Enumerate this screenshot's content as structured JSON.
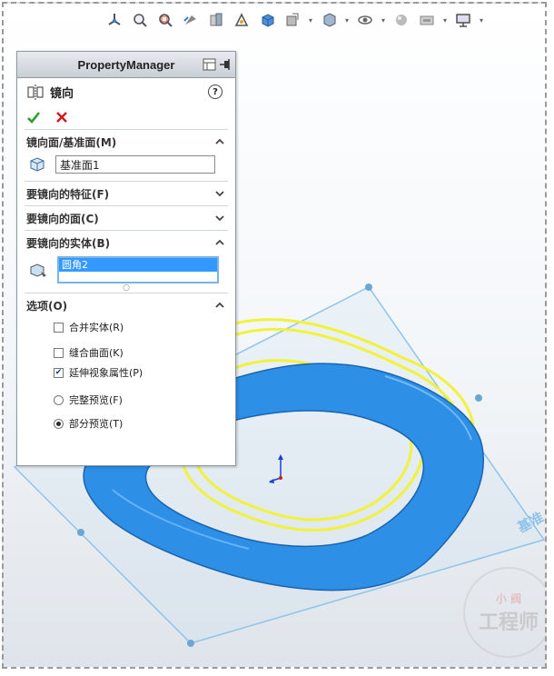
{
  "property_manager": {
    "title": "PropertyManager",
    "feature_name": "镜向",
    "help_glyph": "?",
    "sections": {
      "mirror_plane": {
        "label": "镜向面/基准面(M)",
        "value": "基准面1"
      },
      "features": {
        "label": "要镜向的特征(F)"
      },
      "faces": {
        "label": "要镜向的面(C)"
      },
      "bodies": {
        "label": "要镜向的实体(B)",
        "selected": "圆角2"
      },
      "options": {
        "label": "选项(O)",
        "merge_solids": {
          "label": "合并实体(R)",
          "checked": false
        },
        "knit_surfaces": {
          "label": "缝合曲面(K)",
          "checked": false
        },
        "propagate_visual": {
          "label": "延伸视象属性(P)",
          "checked": true
        },
        "full_preview": {
          "label": "完整预览(F)",
          "selected": false
        },
        "partial_preview": {
          "label": "部分预览(T)",
          "selected": true
        }
      }
    }
  },
  "viewport": {
    "plane_name": "基准",
    "watermark_top": "小 阀",
    "watermark_text": "工程师"
  },
  "colors": {
    "part_blue": "#2d8fe6",
    "preview_yellow": "#f2f23a",
    "annotation_red": "#e01010",
    "plane_edge": "#8fc3ea"
  },
  "icons": [
    "standard-views-icon",
    "zoom-to-fit-icon",
    "zoom-area-icon",
    "previous-view-icon",
    "section-view-icon",
    "dynamic-annotation-icon",
    "view-orientation-icon",
    "display-style-icon",
    "hide-show-icon",
    "edit-appearance-icon",
    "apply-scene-icon",
    "view-settings-icon"
  ]
}
